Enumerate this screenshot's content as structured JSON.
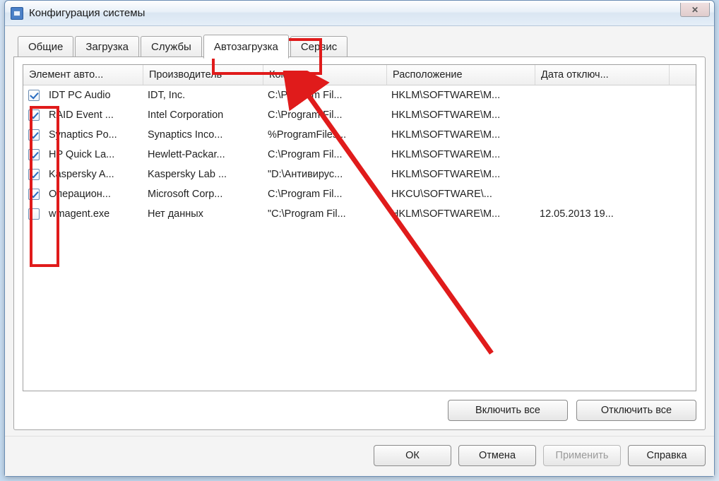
{
  "window": {
    "title": "Конфигурация системы",
    "close_glyph": "✕"
  },
  "tabs": [
    {
      "label": "Общие"
    },
    {
      "label": "Загрузка"
    },
    {
      "label": "Службы"
    },
    {
      "label": "Автозагрузка",
      "active": true
    },
    {
      "label": "Сервис"
    }
  ],
  "columns": {
    "c0": "Элемент авто...",
    "c1": "Производитель",
    "c2": "Команда",
    "c3": "Расположение",
    "c4": "Дата отключ..."
  },
  "rows": [
    {
      "checked": true,
      "item": "IDT PC Audio",
      "mfr": "IDT, Inc.",
      "cmd": "C:\\Program Fil...",
      "loc": "HKLM\\SOFTWARE\\M...",
      "date": ""
    },
    {
      "checked": true,
      "item": "RAID Event ...",
      "mfr": "Intel Corporation",
      "cmd": "C:\\Program Fil...",
      "loc": "HKLM\\SOFTWARE\\M...",
      "date": ""
    },
    {
      "checked": true,
      "item": "Synaptics Po...",
      "mfr": "Synaptics Inco...",
      "cmd": "%ProgramFiles...",
      "loc": "HKLM\\SOFTWARE\\M...",
      "date": ""
    },
    {
      "checked": true,
      "item": "HP Quick La...",
      "mfr": "Hewlett-Packar...",
      "cmd": "C:\\Program Fil...",
      "loc": "HKLM\\SOFTWARE\\M...",
      "date": ""
    },
    {
      "checked": true,
      "item": "Kaspersky A...",
      "mfr": "Kaspersky Lab ...",
      "cmd": "\"D:\\Антивирус...",
      "loc": "HKLM\\SOFTWARE\\M...",
      "date": ""
    },
    {
      "checked": true,
      "item": "Операцион...",
      "mfr": "Microsoft Corp...",
      "cmd": "C:\\Program Fil...",
      "loc": "HKCU\\SOFTWARE\\...",
      "date": ""
    },
    {
      "checked": false,
      "item": "wmagent.exe",
      "mfr": "Нет данных",
      "cmd": "\"C:\\Program Fil...",
      "loc": "HKLM\\SOFTWARE\\M...",
      "date": "12.05.2013 19..."
    }
  ],
  "panel_buttons": {
    "enable_all": "Включить все",
    "disable_all": "Отключить все"
  },
  "dialog_buttons": {
    "ok": "ОК",
    "cancel": "Отмена",
    "apply": "Применить",
    "help": "Справка"
  }
}
